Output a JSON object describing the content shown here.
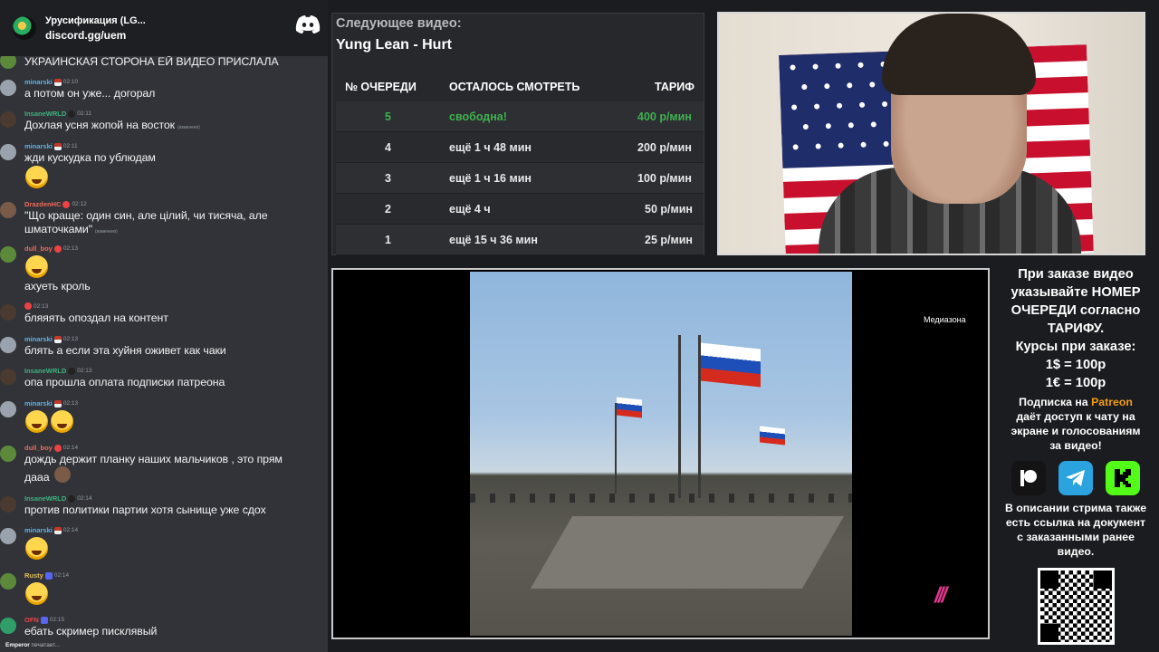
{
  "chat": {
    "server_name": "Урусификация (LG...",
    "server_link": "discord.gg/uem",
    "messages": [
      {
        "user": "",
        "time": "",
        "text": "УКРАИНСКАЯ СТОРОНА ЕЙ ВИДЕО ПРИСЛАЛА"
      },
      {
        "user": "minarski",
        "time": "02:10",
        "text": "а потом он уже... догорал"
      },
      {
        "user": "InsaneWRLD",
        "time": "02:11",
        "text": "Дохлая усня жопой на восток",
        "edited": "(изменено)"
      },
      {
        "user": "minarski",
        "time": "02:11",
        "text": "жди кускудка по ублюдам"
      },
      {
        "user": "DrazdenHC",
        "time": "02:12",
        "text": "\"Що краще: один син, але цілий, чи тисяча, але",
        "text2": "шматочками\"",
        "edited": "(изменено)"
      },
      {
        "user": "dull_boy",
        "time": "02:13",
        "text": "ахуеть кроль"
      },
      {
        "user": "",
        "time": "02:13",
        "text": "бляяять опоздал на контент"
      },
      {
        "user": "minarski",
        "time": "02:13",
        "text": "блять а если эта хуйня оживет как чаки"
      },
      {
        "user": "InsaneWRLD",
        "time": "02:13",
        "text": "опа прошла оплата подписки патреона"
      },
      {
        "user": "minarski",
        "time": "02:13",
        "text": ""
      },
      {
        "user": "dull_boy",
        "time": "02:14",
        "text": "дождь держит планку наших мальчиков , это прям",
        "text2": "дааа"
      },
      {
        "user": "InsaneWRLD",
        "time": "02:14",
        "text": "против политики партии хотя сынище уже сдох"
      },
      {
        "user": "minarski",
        "time": "02:14",
        "text": ""
      },
      {
        "user": "Rusty",
        "time": "02:14",
        "text": ""
      },
      {
        "user": "OFN",
        "time": "02:15",
        "text": "ебать скример писклявый"
      }
    ],
    "typing_user": "Emperor",
    "typing_text": "печатает..."
  },
  "queue": {
    "next_label": "Следующее видео:",
    "next_title": "Yung Lean - Hurt",
    "headers": [
      "№ ОЧЕРЕДИ",
      "ОСТАЛОСЬ СМОТРЕТЬ",
      "ТАРИФ"
    ],
    "rows": [
      {
        "num": "5",
        "remaining": "свободна!",
        "rate": "400 р/мин",
        "free": true
      },
      {
        "num": "4",
        "remaining": "ещё 1 ч 48 мин",
        "rate": "200 р/мин",
        "free": false
      },
      {
        "num": "3",
        "remaining": "ещё 1 ч 16 мин",
        "rate": "100 р/мин",
        "free": false
      },
      {
        "num": "2",
        "remaining": "ещё 4 ч",
        "rate": "50 р/мин",
        "free": false
      },
      {
        "num": "1",
        "remaining": "ещё 15 ч 36 мин",
        "rate": "25 р/мин",
        "free": false
      }
    ]
  },
  "video": {
    "watermark": "Медиазона",
    "logo": "///"
  },
  "info": {
    "heading_lines": [
      "При заказе видео",
      "указывайте НОМЕР",
      "ОЧЕРЕДИ согласно",
      "ТАРИФУ."
    ],
    "rates_title": "Курсы при заказе:",
    "rate_usd": "1$ = 100р",
    "rate_eur": "1€ = 100р",
    "sub_pre": "Подписка на ",
    "sub_brand": "Patreon",
    "sub_rest_lines": [
      "даёт доступ к чату на",
      "экране и голосованиям",
      "за видео!"
    ],
    "footer_lines": [
      "В описании стрима также",
      "есть ссылка на документ",
      "с заказанными ранее",
      "видео."
    ],
    "icons": [
      "patreon-icon",
      "telegram-icon",
      "kick-icon"
    ]
  }
}
